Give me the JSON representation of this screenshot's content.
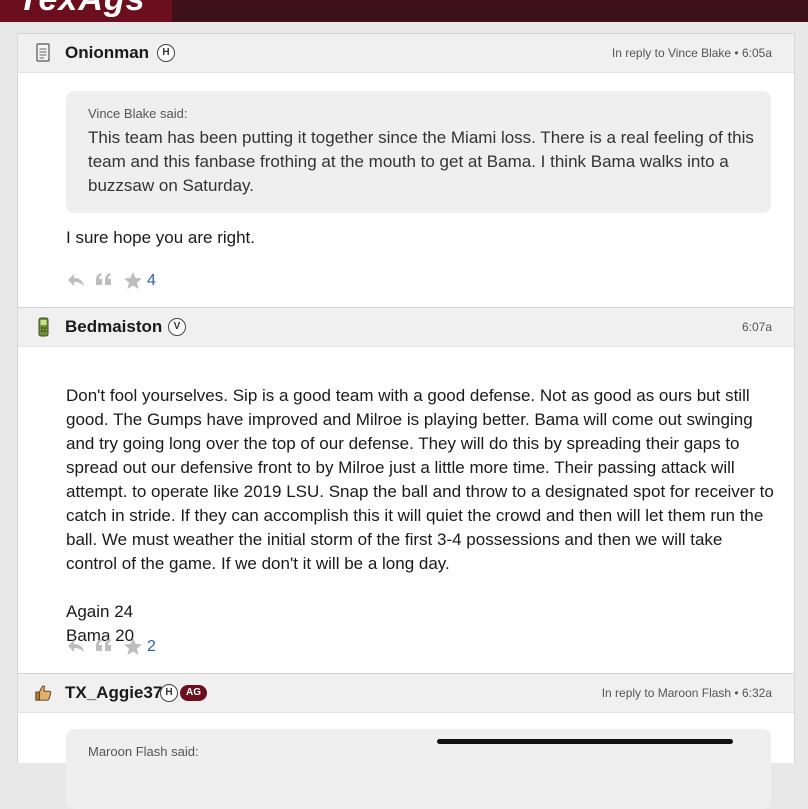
{
  "site": {
    "logo": "TexAgs"
  },
  "posts": [
    {
      "username": "Onionman",
      "badge": "H",
      "meta": "In reply to Vince Blake • 6:05a",
      "quote_author": "Vince Blake said:",
      "quote_text": "This team has been putting it together since the Miami loss. There is a real feeling of this team and this fanbase frothing at the mouth to get at Bama. I think Bama walks into a buzzsaw on Saturday.",
      "body": "I sure hope you are right.",
      "star_count": "4",
      "avatar_icon": "notepad-icon"
    },
    {
      "username": "Bedmaiston",
      "badge": "V",
      "meta": "6:07a",
      "body": "Don't fool yourselves. Sip is a good team with a good defense. Not as good as ours but still good. The Gumps have improved and Milroe is playing better. Bama will come out swinging and try going long over the top of our defense. They will do this by spreading their gaps to spread out our defensive front to by Milroe just a little more time. Their passing attack will attempt. to operate like 2019 LSU. Snap the ball and throw to a designated spot for receiver to catch in stride. If they can accomplish this it will quiet the crowd and then will let them run the ball. We must weather the initial storm of the first 3-4 possessions and then we will take control of the game. If we don't it will be a long day.",
      "body_line2": "Again 24",
      "body_line3": "Bama 20",
      "star_count": "2",
      "avatar_icon": "cellphone-icon"
    },
    {
      "username": "TX_Aggie37",
      "badge": "H",
      "badge2": "AG",
      "meta": "In reply to Maroon Flash • 6:32a",
      "quote_author": "Maroon Flash said:",
      "avatar_icon": "thumbs-up-icon"
    }
  ],
  "colors": {
    "maroon": "#6b0f1f",
    "topbar": "#3d1018",
    "link_blue": "#2e5fa6"
  }
}
